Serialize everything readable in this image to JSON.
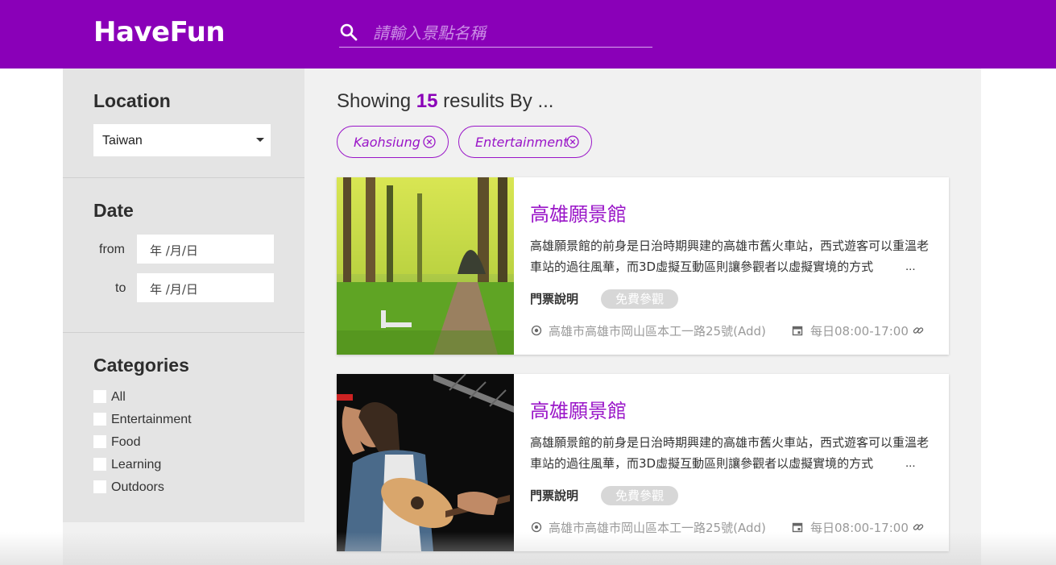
{
  "header": {
    "logo": "HaveFun",
    "search_placeholder": "請輸入景點名稱"
  },
  "sidebar": {
    "location": {
      "title": "Location",
      "selected": "Taiwan"
    },
    "date": {
      "title": "Date",
      "from_label": "from",
      "to_label": "to",
      "from_value": "年 /月/日",
      "to_value": "年 /月/日"
    },
    "categories": {
      "title": "Categories",
      "items": [
        {
          "label": "All",
          "checked": false
        },
        {
          "label": "Entertainment",
          "checked": false
        },
        {
          "label": "Food",
          "checked": false
        },
        {
          "label": "Learning",
          "checked": false
        },
        {
          "label": "Outdoors",
          "checked": false
        }
      ]
    }
  },
  "results": {
    "prefix": "Showing ",
    "count": "15",
    "suffix": " resulits By ...",
    "filters": [
      {
        "label": "Kaohsiung"
      },
      {
        "label": "Entertainment"
      }
    ],
    "cards": [
      {
        "title": "高雄願景館",
        "description": "高雄願景館的前身是日治時期興建的高雄市舊火車站，西式遊客可以重溫老車站的過往風華，而3D虛擬互動區則讓參觀者以虛擬實境的方式",
        "ellipsis": "...",
        "ticket_label": "門票說明",
        "ticket_badge": "免費參觀",
        "address": "高雄市高雄市岡山區本工一路25號(Add)",
        "hours": "每日08:00-17:00",
        "image": "forest-park-photo"
      },
      {
        "title": "高雄願景館",
        "description": "高雄願景館的前身是日治時期興建的高雄市舊火車站，西式遊客可以重溫老車站的過往風華，而3D虛擬互動區則讓參觀者以虛擬實境的方式",
        "ellipsis": "...",
        "ticket_label": "門票說明",
        "ticket_badge": "免費參觀",
        "address": "高雄市高雄市岡山區本工一路25號(Add)",
        "hours": "每日08:00-17:00",
        "image": "concert-singer-photo"
      }
    ]
  },
  "colors": {
    "brand": "#8a00b8",
    "accent": "#9a16c8",
    "sidebar_bg": "#e4e4e4",
    "content_bg": "#f1f1f1"
  }
}
